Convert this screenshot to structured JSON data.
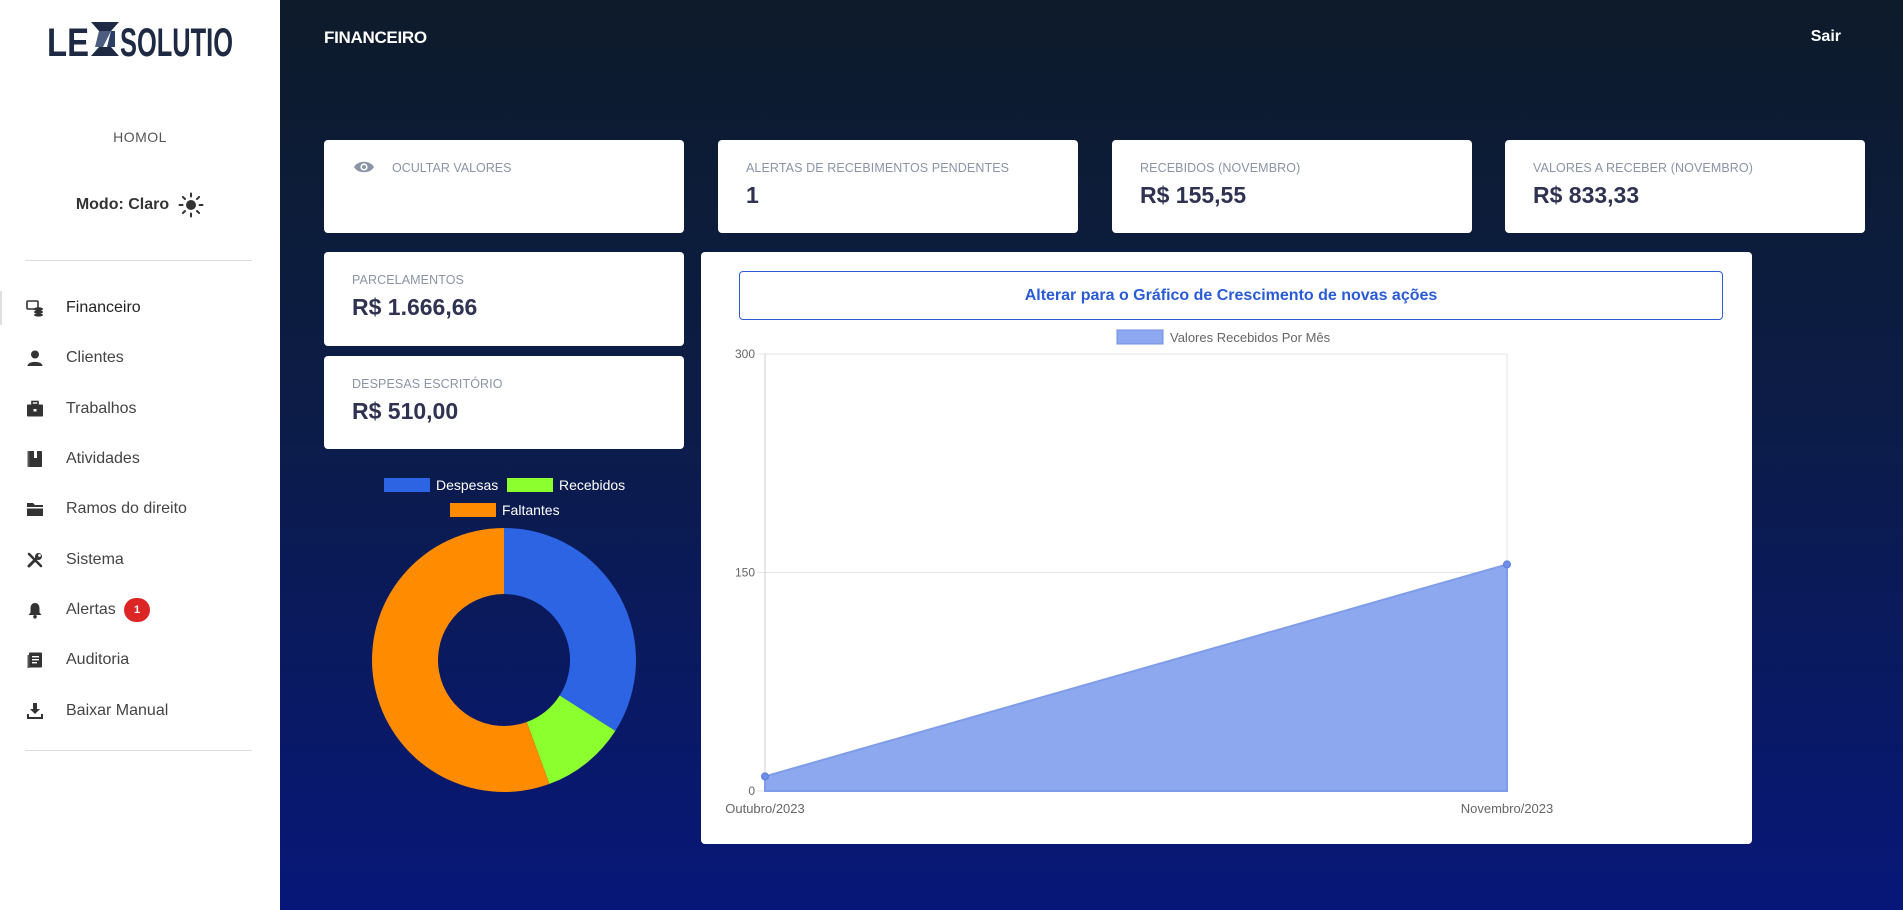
{
  "sidebar": {
    "logo": {
      "left": "LE",
      "right": "SOLUTIO"
    },
    "env": "HOMOL",
    "mode_label": "Modo: Claro",
    "items": [
      {
        "label": "Financeiro",
        "icon": "finance-icon",
        "active": true
      },
      {
        "label": "Clientes",
        "icon": "person-icon"
      },
      {
        "label": "Trabalhos",
        "icon": "briefcase-icon"
      },
      {
        "label": "Atividades",
        "icon": "book-icon"
      },
      {
        "label": "Ramos do direito",
        "icon": "folder-icon"
      },
      {
        "label": "Sistema",
        "icon": "tools-icon"
      },
      {
        "label": "Alertas",
        "icon": "bell-icon",
        "badge": "1"
      },
      {
        "label": "Auditoria",
        "icon": "document-icon"
      },
      {
        "label": "Baixar Manual",
        "icon": "download-icon"
      }
    ]
  },
  "header": {
    "title": "FINANCEIRO",
    "logout": "Sair"
  },
  "cards": {
    "hide": {
      "label": "OCULTAR VALORES"
    },
    "alerts": {
      "label": "ALERTAS DE RECEBIMENTOS PENDENTES",
      "value": "1"
    },
    "received": {
      "label": "RECEBIDOS (NOVEMBRO)",
      "value": "R$ 155,55"
    },
    "to_receive": {
      "label": "VALORES A RECEBER (NOVEMBRO)",
      "value": "R$ 833,33"
    },
    "installments": {
      "label": "PARCELAMENTOS",
      "value": "R$ 1.666,66"
    },
    "expenses": {
      "label": "DESPESAS ESCRITÓRIO",
      "value": "R$ 510,00"
    }
  },
  "colors": {
    "accent": "#2a5bd7",
    "despesas": "#2c64e3",
    "recebidos": "#8cff2e",
    "faltantes": "#ff8c00",
    "area_fill": "#8da8ef",
    "badge": "#dc2626"
  },
  "switch_button": "Alterar para o Gráfico de Crescimento de novas ações",
  "chart_data": [
    {
      "type": "area",
      "series": [
        {
          "name": "Valores Recebidos Por Mês",
          "values": [
            10,
            155.55
          ]
        }
      ],
      "categories": [
        "Outubro/2023",
        "Novembro/2023"
      ],
      "y_ticks": [
        "0",
        "150",
        "300"
      ],
      "ylim": [
        0,
        300
      ],
      "legend": "top-center"
    },
    {
      "type": "pie",
      "donut": true,
      "slices": [
        {
          "label": "Despesas",
          "value": 510.0
        },
        {
          "label": "Recebidos",
          "value": 155.55
        },
        {
          "label": "Faltantes",
          "value": 833.33
        }
      ],
      "legend": "top"
    }
  ]
}
